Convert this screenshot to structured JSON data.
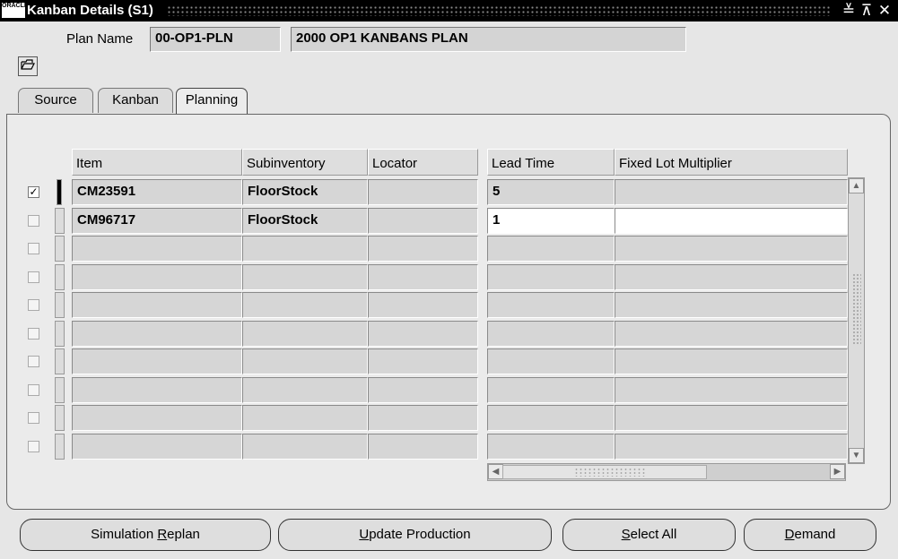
{
  "window": {
    "logo_text": "ORACLE",
    "title": "Kanban Details (S1)",
    "controls": [
      "≚",
      "⊼",
      "✕"
    ]
  },
  "plan": {
    "label": "Plan Name",
    "code": "00-OP1-PLN",
    "description": "2000 OP1 KANBANS PLAN"
  },
  "toolbar": {
    "folder_icon": "folder-icon"
  },
  "tabs": [
    {
      "label": "Source",
      "active": false
    },
    {
      "label": "Kanban",
      "active": false
    },
    {
      "label": "Planning",
      "active": true
    }
  ],
  "grid": {
    "headers": {
      "item": "Item",
      "subinventory": "Subinventory",
      "locator": "Locator",
      "lead_time": "Lead Time",
      "fixed_lot_multiplier": "Fixed Lot Multiplier"
    },
    "rows": [
      {
        "checked": true,
        "item": "CM23591",
        "subinventory": "FloorStock",
        "locator": "",
        "lead_time": "5",
        "fixed_lot_multiplier": ""
      },
      {
        "checked": false,
        "item": "CM96717",
        "subinventory": "FloorStock",
        "locator": "",
        "lead_time": "1",
        "fixed_lot_multiplier": ""
      },
      {
        "checked": false,
        "item": "",
        "subinventory": "",
        "locator": "",
        "lead_time": "",
        "fixed_lot_multiplier": ""
      },
      {
        "checked": false,
        "item": "",
        "subinventory": "",
        "locator": "",
        "lead_time": "",
        "fixed_lot_multiplier": ""
      },
      {
        "checked": false,
        "item": "",
        "subinventory": "",
        "locator": "",
        "lead_time": "",
        "fixed_lot_multiplier": ""
      },
      {
        "checked": false,
        "item": "",
        "subinventory": "",
        "locator": "",
        "lead_time": "",
        "fixed_lot_multiplier": ""
      },
      {
        "checked": false,
        "item": "",
        "subinventory": "",
        "locator": "",
        "lead_time": "",
        "fixed_lot_multiplier": ""
      },
      {
        "checked": false,
        "item": "",
        "subinventory": "",
        "locator": "",
        "lead_time": "",
        "fixed_lot_multiplier": ""
      },
      {
        "checked": false,
        "item": "",
        "subinventory": "",
        "locator": "",
        "lead_time": "",
        "fixed_lot_multiplier": ""
      },
      {
        "checked": false,
        "item": "",
        "subinventory": "",
        "locator": "",
        "lead_time": "",
        "fixed_lot_multiplier": ""
      }
    ]
  },
  "buttons": {
    "simulation_replan": {
      "pre": "Simulation ",
      "accel": "R",
      "post": "eplan"
    },
    "update_production": {
      "pre": "",
      "accel": "U",
      "post": "pdate Production"
    },
    "select_all": {
      "pre": "",
      "accel": "S",
      "post": "elect All"
    },
    "demand": {
      "pre": "",
      "accel": "D",
      "post": "emand"
    }
  }
}
